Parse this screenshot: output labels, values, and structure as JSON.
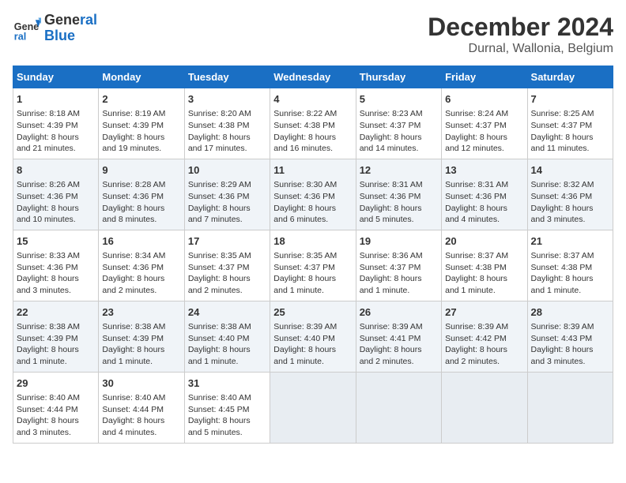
{
  "header": {
    "logo_line1": "General",
    "logo_line2": "Blue",
    "title": "December 2024",
    "subtitle": "Durnal, Wallonia, Belgium"
  },
  "days_of_week": [
    "Sunday",
    "Monday",
    "Tuesday",
    "Wednesday",
    "Thursday",
    "Friday",
    "Saturday"
  ],
  "weeks": [
    [
      {
        "day": "1",
        "lines": [
          "Sunrise: 8:18 AM",
          "Sunset: 4:39 PM",
          "Daylight: 8 hours",
          "and 21 minutes."
        ]
      },
      {
        "day": "2",
        "lines": [
          "Sunrise: 8:19 AM",
          "Sunset: 4:39 PM",
          "Daylight: 8 hours",
          "and 19 minutes."
        ]
      },
      {
        "day": "3",
        "lines": [
          "Sunrise: 8:20 AM",
          "Sunset: 4:38 PM",
          "Daylight: 8 hours",
          "and 17 minutes."
        ]
      },
      {
        "day": "4",
        "lines": [
          "Sunrise: 8:22 AM",
          "Sunset: 4:38 PM",
          "Daylight: 8 hours",
          "and 16 minutes."
        ]
      },
      {
        "day": "5",
        "lines": [
          "Sunrise: 8:23 AM",
          "Sunset: 4:37 PM",
          "Daylight: 8 hours",
          "and 14 minutes."
        ]
      },
      {
        "day": "6",
        "lines": [
          "Sunrise: 8:24 AM",
          "Sunset: 4:37 PM",
          "Daylight: 8 hours",
          "and 12 minutes."
        ]
      },
      {
        "day": "7",
        "lines": [
          "Sunrise: 8:25 AM",
          "Sunset: 4:37 PM",
          "Daylight: 8 hours",
          "and 11 minutes."
        ]
      }
    ],
    [
      {
        "day": "8",
        "lines": [
          "Sunrise: 8:26 AM",
          "Sunset: 4:36 PM",
          "Daylight: 8 hours",
          "and 10 minutes."
        ]
      },
      {
        "day": "9",
        "lines": [
          "Sunrise: 8:28 AM",
          "Sunset: 4:36 PM",
          "Daylight: 8 hours",
          "and 8 minutes."
        ]
      },
      {
        "day": "10",
        "lines": [
          "Sunrise: 8:29 AM",
          "Sunset: 4:36 PM",
          "Daylight: 8 hours",
          "and 7 minutes."
        ]
      },
      {
        "day": "11",
        "lines": [
          "Sunrise: 8:30 AM",
          "Sunset: 4:36 PM",
          "Daylight: 8 hours",
          "and 6 minutes."
        ]
      },
      {
        "day": "12",
        "lines": [
          "Sunrise: 8:31 AM",
          "Sunset: 4:36 PM",
          "Daylight: 8 hours",
          "and 5 minutes."
        ]
      },
      {
        "day": "13",
        "lines": [
          "Sunrise: 8:31 AM",
          "Sunset: 4:36 PM",
          "Daylight: 8 hours",
          "and 4 minutes."
        ]
      },
      {
        "day": "14",
        "lines": [
          "Sunrise: 8:32 AM",
          "Sunset: 4:36 PM",
          "Daylight: 8 hours",
          "and 3 minutes."
        ]
      }
    ],
    [
      {
        "day": "15",
        "lines": [
          "Sunrise: 8:33 AM",
          "Sunset: 4:36 PM",
          "Daylight: 8 hours",
          "and 3 minutes."
        ]
      },
      {
        "day": "16",
        "lines": [
          "Sunrise: 8:34 AM",
          "Sunset: 4:36 PM",
          "Daylight: 8 hours",
          "and 2 minutes."
        ]
      },
      {
        "day": "17",
        "lines": [
          "Sunrise: 8:35 AM",
          "Sunset: 4:37 PM",
          "Daylight: 8 hours",
          "and 2 minutes."
        ]
      },
      {
        "day": "18",
        "lines": [
          "Sunrise: 8:35 AM",
          "Sunset: 4:37 PM",
          "Daylight: 8 hours",
          "and 1 minute."
        ]
      },
      {
        "day": "19",
        "lines": [
          "Sunrise: 8:36 AM",
          "Sunset: 4:37 PM",
          "Daylight: 8 hours",
          "and 1 minute."
        ]
      },
      {
        "day": "20",
        "lines": [
          "Sunrise: 8:37 AM",
          "Sunset: 4:38 PM",
          "Daylight: 8 hours",
          "and 1 minute."
        ]
      },
      {
        "day": "21",
        "lines": [
          "Sunrise: 8:37 AM",
          "Sunset: 4:38 PM",
          "Daylight: 8 hours",
          "and 1 minute."
        ]
      }
    ],
    [
      {
        "day": "22",
        "lines": [
          "Sunrise: 8:38 AM",
          "Sunset: 4:39 PM",
          "Daylight: 8 hours",
          "and 1 minute."
        ]
      },
      {
        "day": "23",
        "lines": [
          "Sunrise: 8:38 AM",
          "Sunset: 4:39 PM",
          "Daylight: 8 hours",
          "and 1 minute."
        ]
      },
      {
        "day": "24",
        "lines": [
          "Sunrise: 8:38 AM",
          "Sunset: 4:40 PM",
          "Daylight: 8 hours",
          "and 1 minute."
        ]
      },
      {
        "day": "25",
        "lines": [
          "Sunrise: 8:39 AM",
          "Sunset: 4:40 PM",
          "Daylight: 8 hours",
          "and 1 minute."
        ]
      },
      {
        "day": "26",
        "lines": [
          "Sunrise: 8:39 AM",
          "Sunset: 4:41 PM",
          "Daylight: 8 hours",
          "and 2 minutes."
        ]
      },
      {
        "day": "27",
        "lines": [
          "Sunrise: 8:39 AM",
          "Sunset: 4:42 PM",
          "Daylight: 8 hours",
          "and 2 minutes."
        ]
      },
      {
        "day": "28",
        "lines": [
          "Sunrise: 8:39 AM",
          "Sunset: 4:43 PM",
          "Daylight: 8 hours",
          "and 3 minutes."
        ]
      }
    ],
    [
      {
        "day": "29",
        "lines": [
          "Sunrise: 8:40 AM",
          "Sunset: 4:44 PM",
          "Daylight: 8 hours",
          "and 3 minutes."
        ]
      },
      {
        "day": "30",
        "lines": [
          "Sunrise: 8:40 AM",
          "Sunset: 4:44 PM",
          "Daylight: 8 hours",
          "and 4 minutes."
        ]
      },
      {
        "day": "31",
        "lines": [
          "Sunrise: 8:40 AM",
          "Sunset: 4:45 PM",
          "Daylight: 8 hours",
          "and 5 minutes."
        ]
      },
      {
        "day": "",
        "lines": []
      },
      {
        "day": "",
        "lines": []
      },
      {
        "day": "",
        "lines": []
      },
      {
        "day": "",
        "lines": []
      }
    ]
  ]
}
